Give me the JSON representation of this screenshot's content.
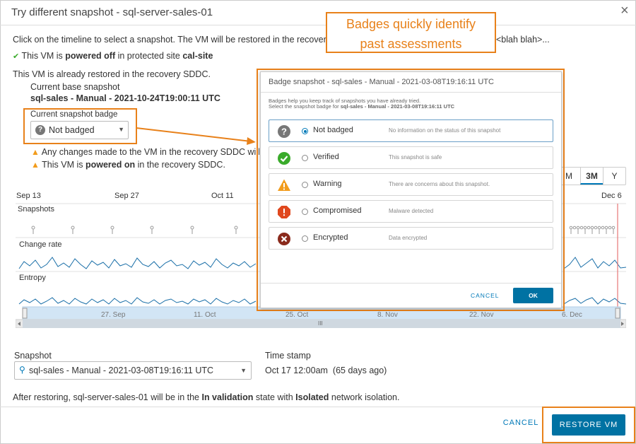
{
  "dialog": {
    "title_prefix": "Try different snapshot - ",
    "title_vm": "sql-server-sales-01",
    "close_glyph": "×"
  },
  "info": {
    "instruction": "Click on the timeline to select a snapshot. The VM will be restored in the recovery SDDC",
    "instruction_tail": "<blah blah>...",
    "powered_off_prefix": "This VM is ",
    "powered_off_state": "powered off",
    "powered_off_mid": " in protected site ",
    "powered_off_site": "cal-site",
    "restored_note": "This VM is already restored in the recovery SDDC.",
    "current_base_label": "Current base snapshot",
    "current_base_value": "sql-sales - Manual - 2021-10-24T19:00:11 UTC",
    "current_badge_label": "Current snapshot badge",
    "current_badge_value": "Not badged",
    "warning_changes": "Any changes made to the VM in the recovery SDDC will be l",
    "warning_power_prefix": "This VM is ",
    "warning_power_state": "powered on",
    "warning_power_suffix": " in the recovery SDDC."
  },
  "timeline": {
    "date_labels": [
      "Sep 13",
      "Sep 27",
      "Oct 11",
      "Dec 6"
    ],
    "row_labels": [
      "Snapshots",
      "Change rate",
      "Entropy"
    ],
    "range_buttons": [
      "M",
      "3M",
      "Y"
    ],
    "active_range": "3M",
    "scroll_labels": [
      "27. Sep",
      "11. Oct",
      "25. Oct",
      "8. Nov",
      "22. Nov",
      "6. Dec"
    ],
    "scroll_grip": "III"
  },
  "snapshot": {
    "label": "Snapshot",
    "value": "sql-sales - Manual - 2021-03-08T19:16:11 UTC",
    "timestamp_label": "Time stamp",
    "timestamp_value": "Oct 17 12:00am",
    "timestamp_ago": "(65 days ago)"
  },
  "after_restore": {
    "prefix": "After restoring, sql-server-sales-01 will be in the ",
    "state": "In validation",
    "mid": " state with ",
    "isolation": "Isolated",
    "suffix": " network isolation."
  },
  "footer": {
    "cancel_label": "CANCEL",
    "restore_label": "RESTORE VM"
  },
  "callout": {
    "line1": "Badges quickly identify",
    "line2": "past assessments"
  },
  "modal": {
    "title": "Badge snapshot - sql-sales - Manual - 2021-03-08T19:16:11 UTC",
    "desc_line1": "Badges help you keep track of snapshots you have already tried.",
    "desc_line2_prefix": "Select the snapshot badge for ",
    "desc_line2_name": "sql-sales - Manual - 2021-03-08T19:16:11 UTC",
    "options": [
      {
        "name": "Not badged",
        "desc": "No information on the status of this snapshot",
        "icon": "question-icon",
        "color": "#777777"
      },
      {
        "name": "Verified",
        "desc": "This snapshot is safe",
        "icon": "check-circle-icon",
        "color": "#3aab2b"
      },
      {
        "name": "Warning",
        "desc": "There are concerns about this snapshot.",
        "icon": "warning-triangle-icon",
        "color": "#f29c1c"
      },
      {
        "name": "Compromised",
        "desc": "Malware detected",
        "icon": "error-octagon-icon",
        "color": "#e0481e"
      },
      {
        "name": "Encrypted",
        "desc": "Data encrypted",
        "icon": "x-circle-icon",
        "color": "#8a2a1c"
      }
    ],
    "selected": "Not badged",
    "cancel_label": "CANCEL",
    "ok_label": "OK"
  },
  "colors": {
    "accent": "#0072a3",
    "annotation": "#e8811a",
    "warning": "#f29c1c",
    "success": "#3aab2b"
  }
}
